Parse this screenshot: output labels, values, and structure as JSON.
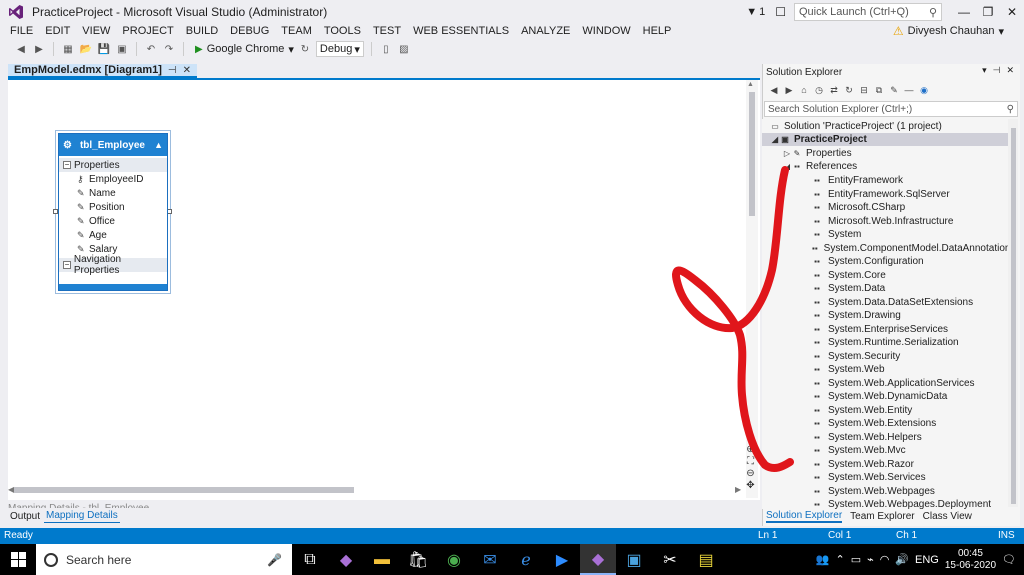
{
  "window": {
    "title": "PracticeProject - Microsoft Visual Studio (Administrator)",
    "notification_count": "1",
    "quick_launch_placeholder": "Quick Launch (Ctrl+Q)"
  },
  "menu": {
    "items": [
      "FILE",
      "EDIT",
      "VIEW",
      "PROJECT",
      "BUILD",
      "DEBUG",
      "TEAM",
      "TOOLS",
      "TEST",
      "WEB ESSENTIALS",
      "ANALYZE",
      "WINDOW",
      "HELP"
    ],
    "user_name": "Divyesh Chauhan"
  },
  "toolbar": {
    "run_target": "Google Chrome",
    "configuration": "Debug"
  },
  "document": {
    "tab_label": "EmpModel.edmx [Diagram1]"
  },
  "entity": {
    "name": "tbl_Employee",
    "properties_label": "Properties",
    "properties": [
      "EmployeeID",
      "Name",
      "Position",
      "Office",
      "Age",
      "Salary"
    ],
    "navigation_label": "Navigation Properties"
  },
  "lower_tabs": {
    "partial_label": "Mapping Details - tbl_Employee",
    "output": "Output",
    "mapping_details": "Mapping Details"
  },
  "solution_explorer": {
    "title": "Solution Explorer",
    "search_placeholder": "Search Solution Explorer (Ctrl+;)",
    "solution": "Solution 'PracticeProject' (1 project)",
    "project": "PracticeProject",
    "properties": "Properties",
    "references": "References",
    "reference_items": [
      "EntityFramework",
      "EntityFramework.SqlServer",
      "Microsoft.CSharp",
      "Microsoft.Web.Infrastructure",
      "System",
      "System.ComponentModel.DataAnnotations",
      "System.Configuration",
      "System.Core",
      "System.Data",
      "System.Data.DataSetExtensions",
      "System.Drawing",
      "System.EnterpriseServices",
      "System.Runtime.Serialization",
      "System.Security",
      "System.Web",
      "System.Web.ApplicationServices",
      "System.Web.DynamicData",
      "System.Web.Entity",
      "System.Web.Extensions",
      "System.Web.Helpers",
      "System.Web.Mvc",
      "System.Web.Razor",
      "System.Web.Services",
      "System.Web.Webpages",
      "System.Web.Webpages.Deployment"
    ],
    "bottom_tabs": [
      "Solution Explorer",
      "Team Explorer",
      "Class View"
    ]
  },
  "status": {
    "ready": "Ready",
    "ln": "Ln 1",
    "col": "Col 1",
    "ch": "Ch 1",
    "ins": "INS"
  },
  "taskbar": {
    "search_placeholder": "Search here",
    "language": "ENG",
    "time": "00:45",
    "date": "15-06-2020"
  },
  "colors": {
    "accent": "#007acc",
    "entity_header": "#1f82d2",
    "annotation": "#e0161b"
  }
}
